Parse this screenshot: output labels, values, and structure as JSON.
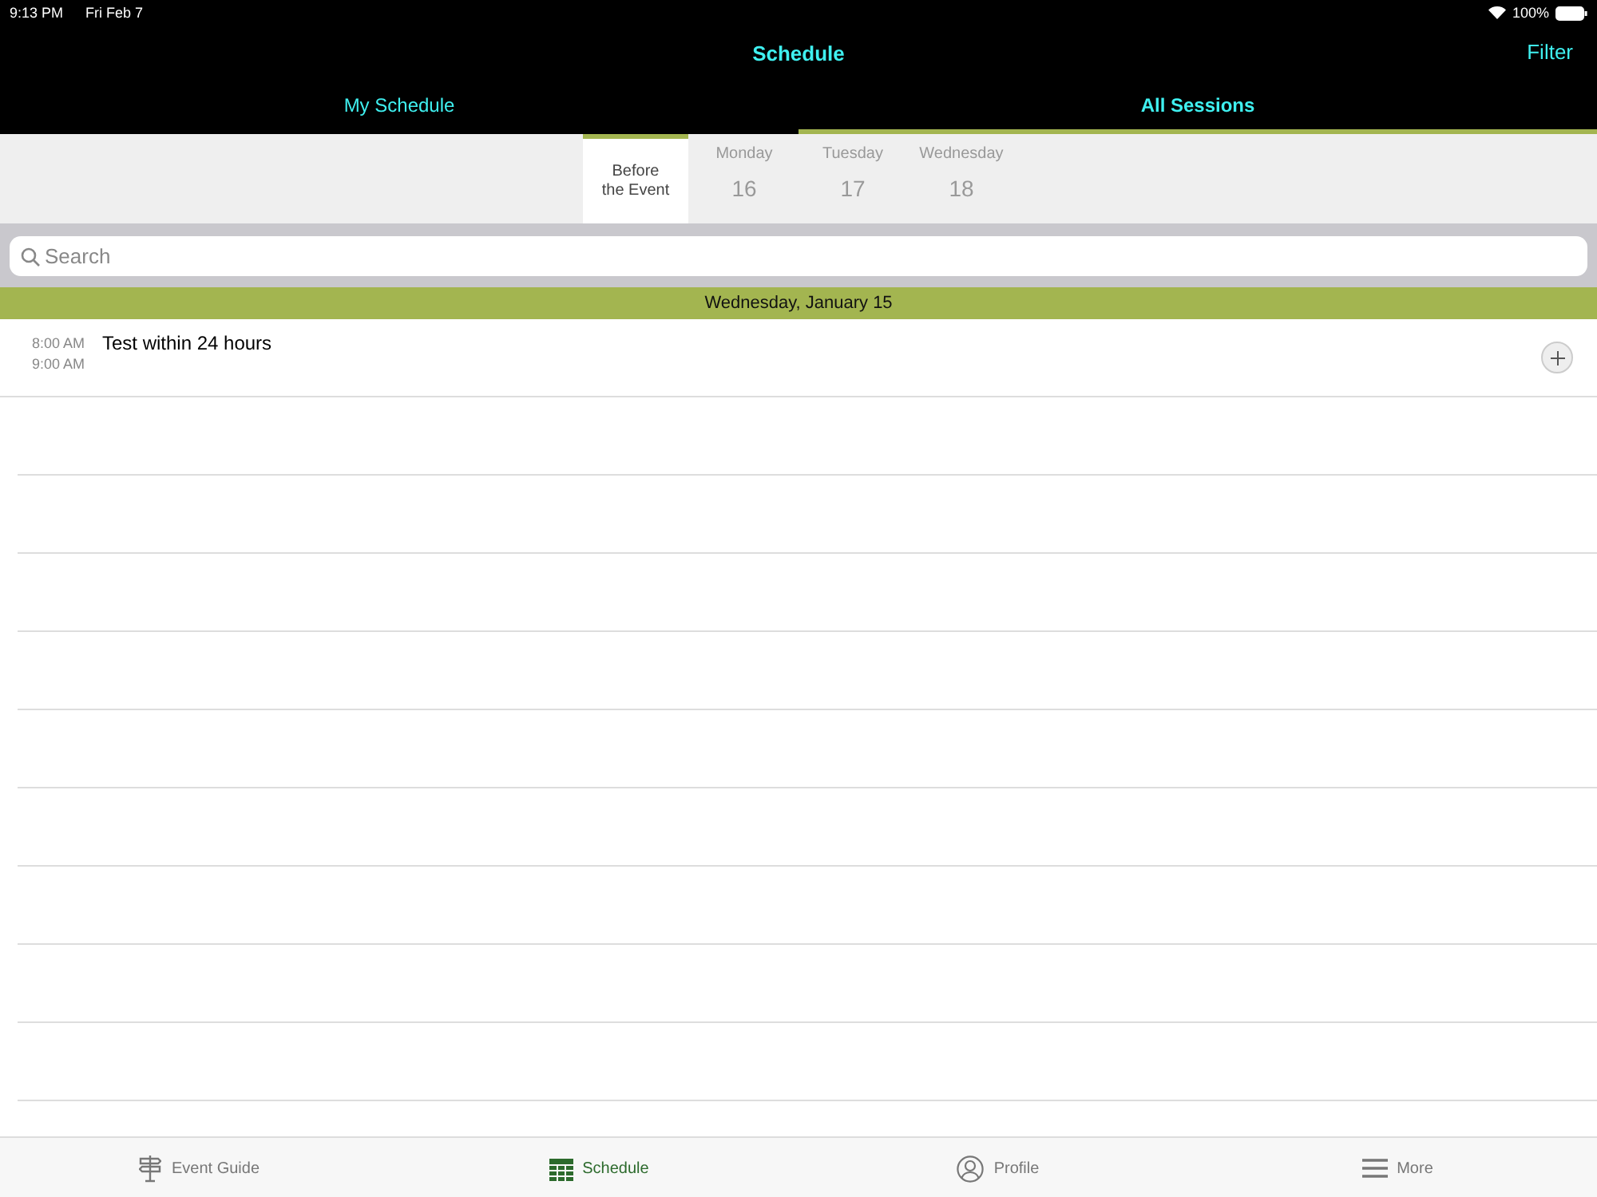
{
  "status_bar": {
    "time": "9:13 PM",
    "date": "Fri Feb 7",
    "battery": "100%"
  },
  "nav_bar": {
    "title": "Schedule",
    "action": "Filter"
  },
  "tabs": [
    {
      "label": "My Schedule",
      "selected": false
    },
    {
      "label": "All Sessions",
      "selected": true
    }
  ],
  "day_tabs": [
    {
      "kind": "label",
      "label": "Before the Event",
      "selected": true
    },
    {
      "kind": "day",
      "label": "Monday",
      "number": "16",
      "selected": false
    },
    {
      "kind": "day",
      "label": "Tuesday",
      "number": "17",
      "selected": false
    },
    {
      "kind": "day",
      "label": "Wednesday",
      "number": "18",
      "selected": false
    }
  ],
  "search": {
    "placeholder": "Search"
  },
  "sections": [
    {
      "header": "Wednesday, January 15",
      "sessions": [
        {
          "start": "8:00 AM",
          "end": "9:00 AM",
          "title": "Test within 24 hours"
        }
      ]
    }
  ],
  "tab_bar": [
    {
      "kind": "guide",
      "label": "Event Guide",
      "selected": false
    },
    {
      "kind": "calendar",
      "label": "Schedule",
      "selected": true
    },
    {
      "kind": "person",
      "label": "Profile",
      "selected": false
    },
    {
      "kind": "menu",
      "label": "More",
      "selected": false
    }
  ]
}
